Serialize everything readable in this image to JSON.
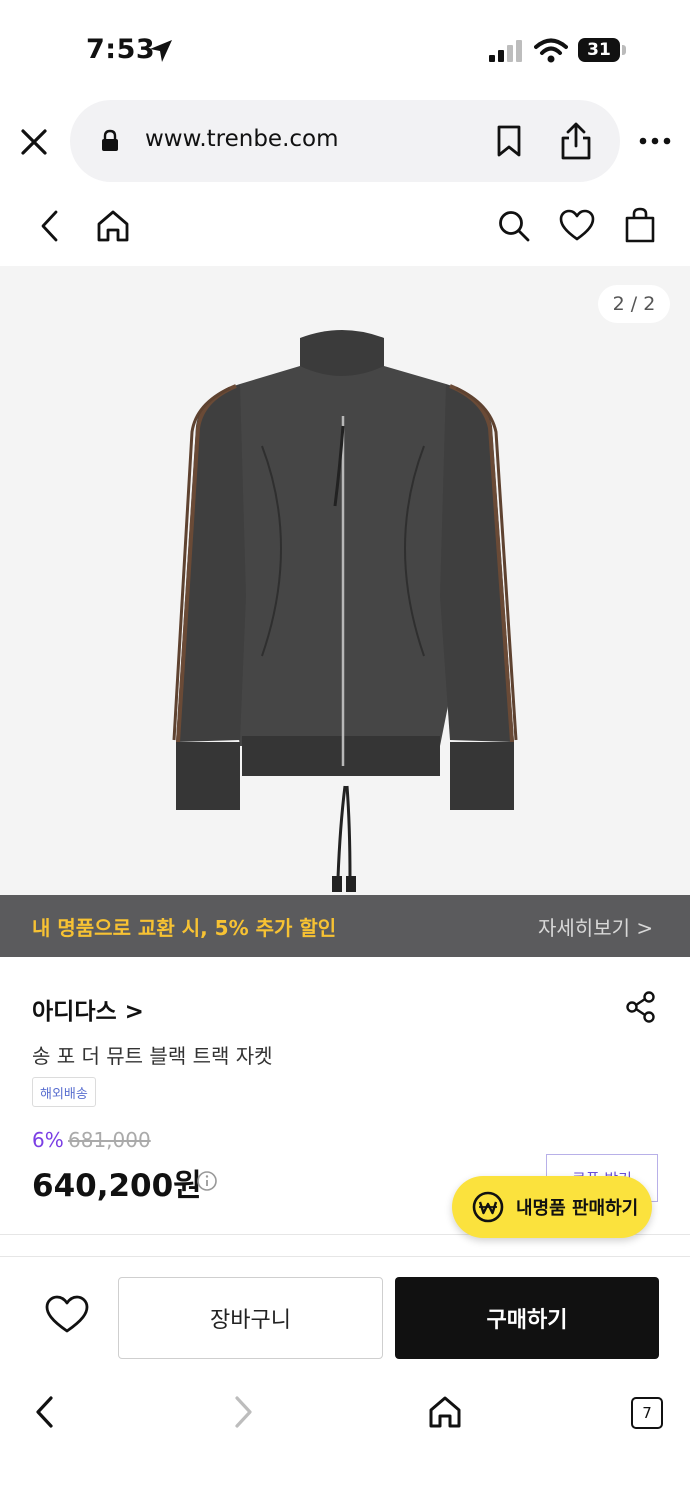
{
  "status_bar": {
    "time": "7:53",
    "battery": "31"
  },
  "browser": {
    "url": "www.trenbe.com",
    "tabs_count": "7"
  },
  "image": {
    "counter": "2 / 2"
  },
  "promo": {
    "text": "내 명품으로 교환 시, 5% 추가 할인",
    "more": "자세히보기 >"
  },
  "product": {
    "brand": "아디다스 >",
    "name": "송 포 더 뮤트 블랙 트랙 자켓",
    "tag": "해외배송",
    "discount": "6%",
    "original_price": "681,000",
    "price": "640,200원",
    "coupon": "쿠폰 받기"
  },
  "sell_button": {
    "label": "내명품 판매하기"
  },
  "actions": {
    "cart": "장바구니",
    "buy": "구매하기"
  },
  "colors": {
    "accent_yellow": "#fbe23d",
    "promo_text": "#f7c233",
    "discount_purple": "#7b3fe4",
    "buy_black": "#111111"
  }
}
